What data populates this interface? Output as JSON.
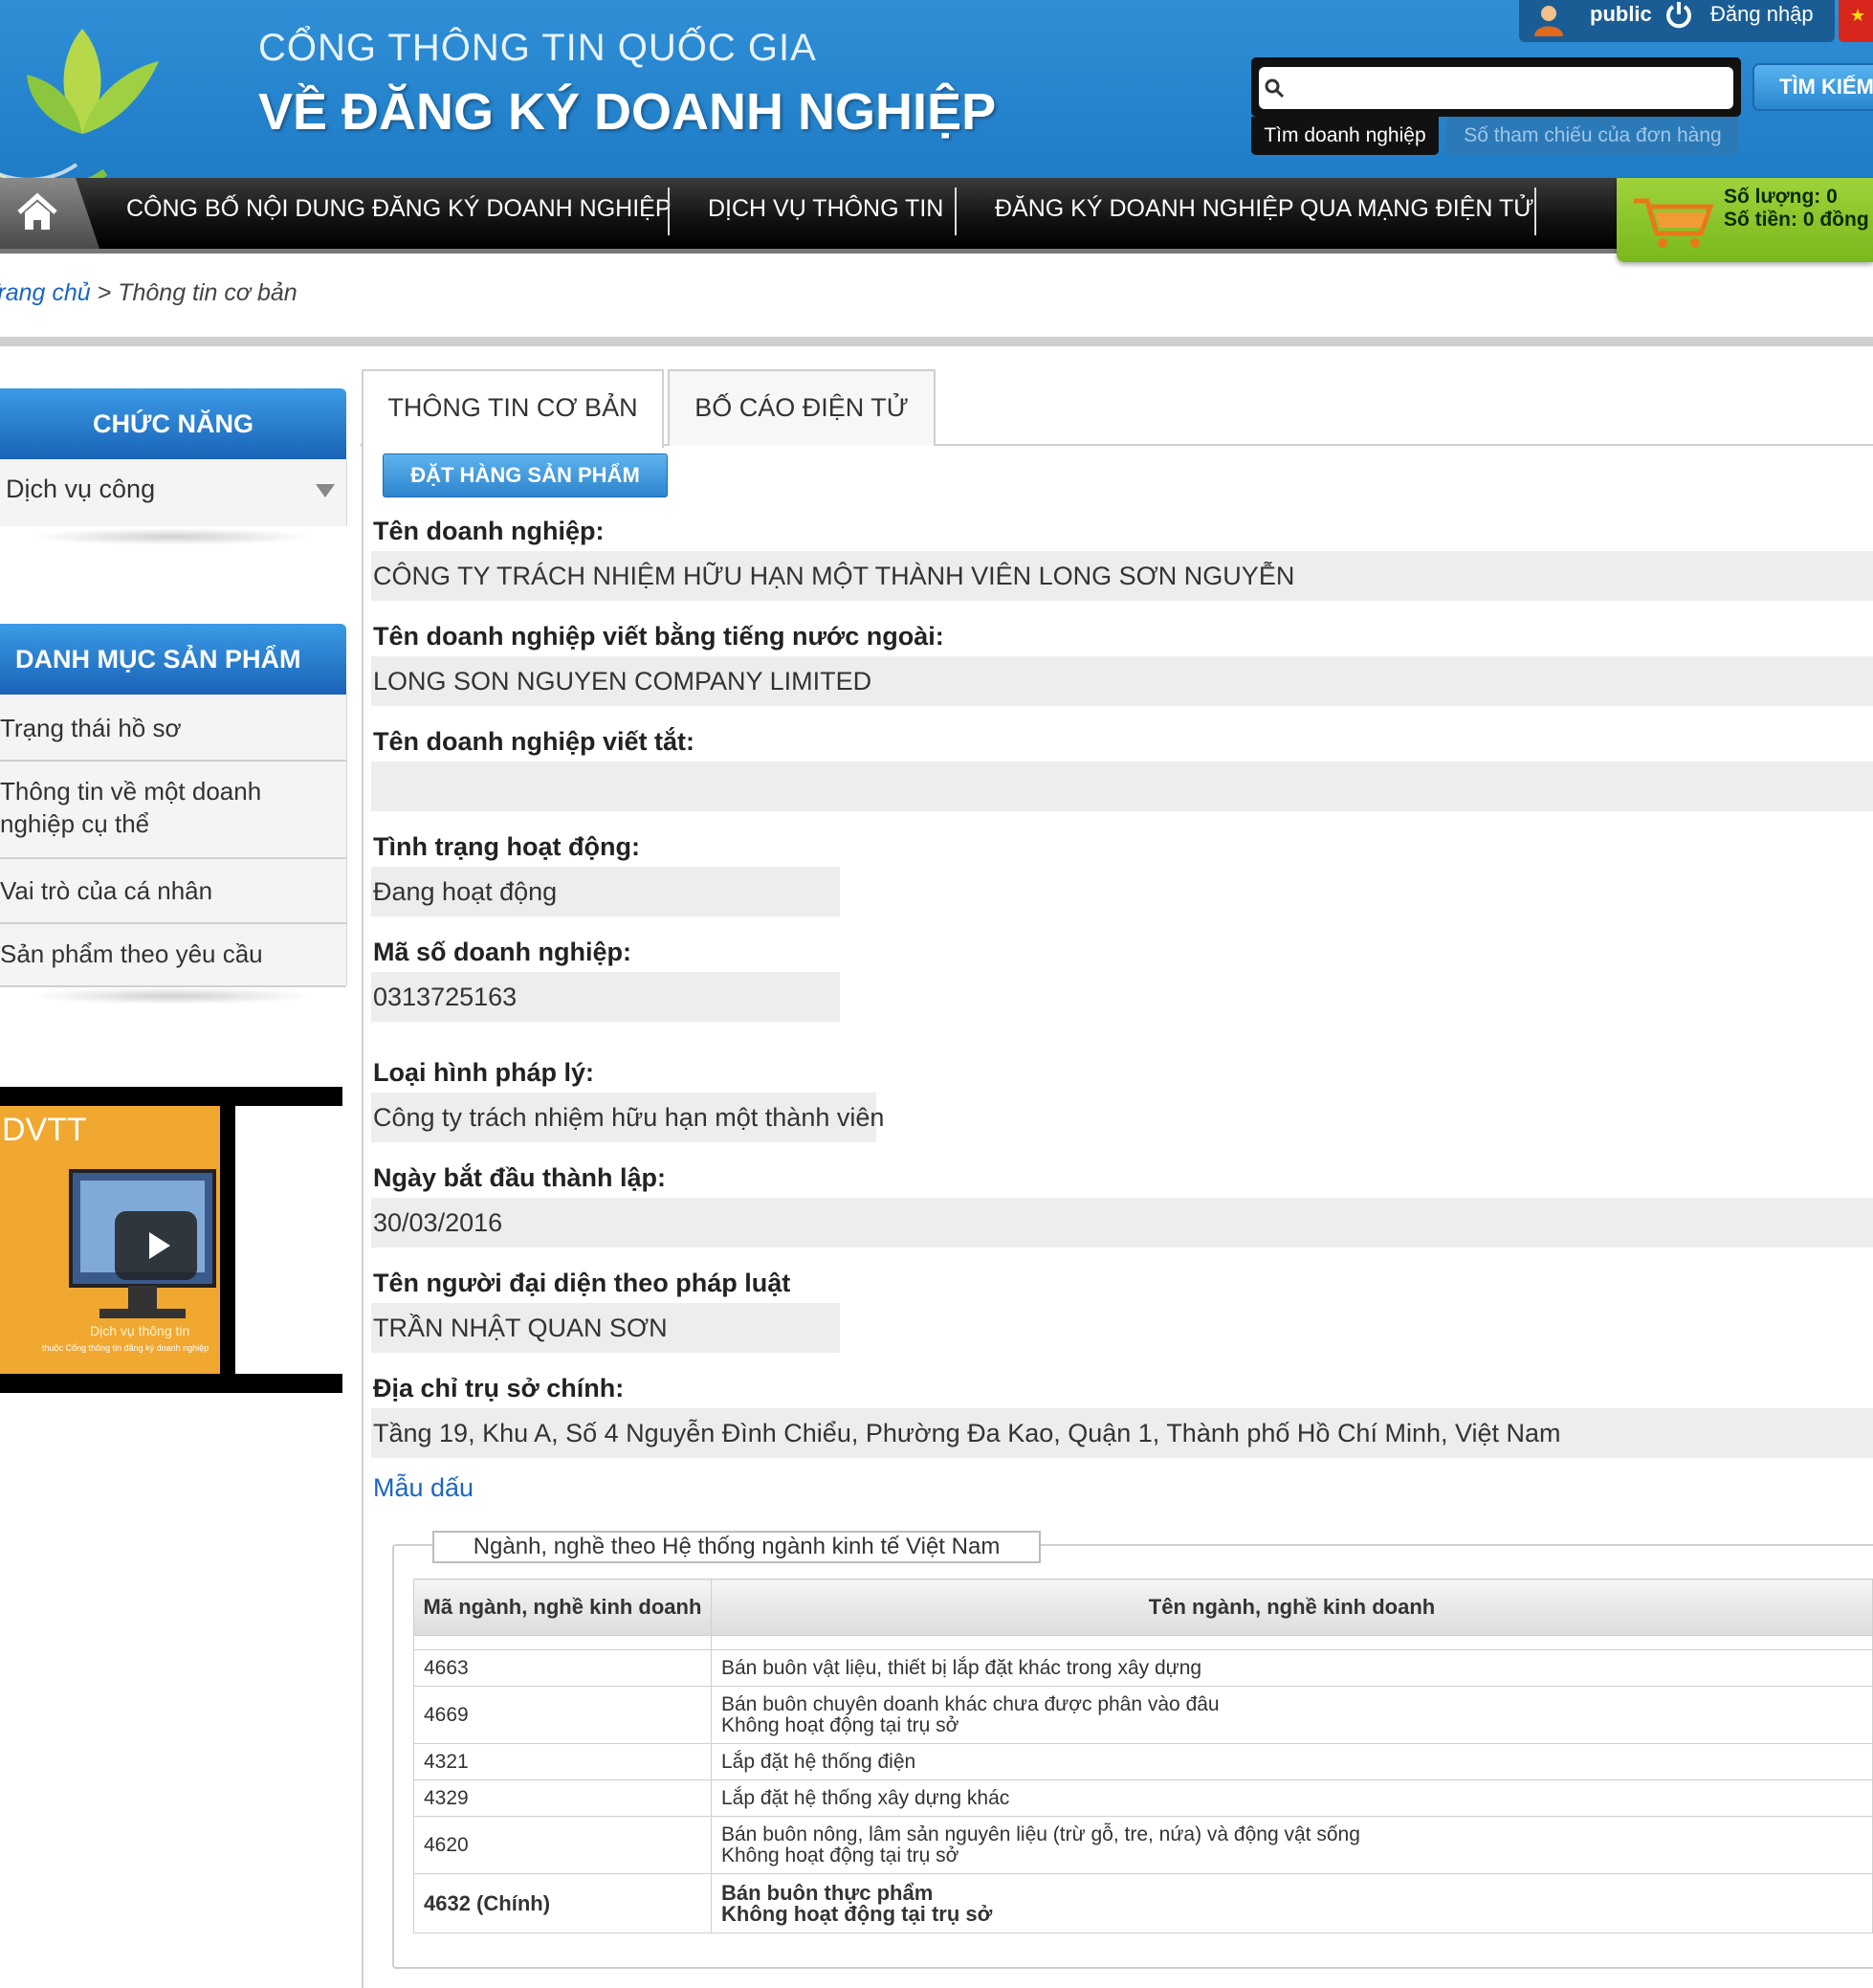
{
  "header": {
    "title_line1": "CỔNG THÔNG TIN QUỐC GIA",
    "title_line2": "VỀ ĐĂNG KÝ DOANH NGHIỆP",
    "user_name": "public",
    "login_label": "Đăng nhập",
    "search_placeholder": "",
    "search_button": "TÌM KIẾM",
    "search_tab_active": "Tìm doanh nghiệp",
    "search_tab_other": "Số tham chiếu của đơn hàng"
  },
  "nav": {
    "items": [
      "CÔNG BỐ NỘI DUNG ĐĂNG KÝ DOANH NGHIỆP",
      "DỊCH VỤ THÔNG TIN",
      "ĐĂNG KÝ DOANH NGHIỆP QUA MẠNG ĐIỆN TỬ"
    ]
  },
  "cart": {
    "quantity_line": "Số lượng: 0",
    "amount_line": "Số tiền: 0 đồng"
  },
  "breadcrumb": {
    "home": "Trang chủ",
    "separator": " > ",
    "current": "Thông tin cơ bản"
  },
  "sidebar": {
    "functions_title": "CHỨC NĂNG",
    "functions_selected": "Dịch vụ công",
    "catalog_title": "DANH MỤC SẢN PHẨM",
    "catalog_items": [
      "Trạng thái hồ sơ",
      "Thông tin về một doanh nghiệp cụ thể",
      "Vai trò của cá nhân",
      "Sản phẩm theo yêu cầu"
    ],
    "video": {
      "title": "DVTT",
      "caption1": "Dịch vụ thông tin",
      "caption2": "thuộc Cổng thông tin đăng ký doanh nghiệp"
    }
  },
  "tabs": [
    "THÔNG TIN CƠ BẢN",
    "BỐ CÁO ĐIỆN TỬ"
  ],
  "order_button": "ĐẶT HÀNG SẢN PHẨM",
  "fields": {
    "name_label": "Tên doanh nghiệp:",
    "name_value": "CÔNG TY TRÁCH NHIỆM HỮU HẠN MỘT THÀNH VIÊN LONG SƠN NGUYỄN",
    "foreign_label": "Tên doanh nghiệp viết bằng tiếng nước ngoài:",
    "foreign_value": "LONG SON NGUYEN COMPANY LIMITED",
    "short_label": "Tên doanh nghiệp viết tắt:",
    "short_value": "",
    "status_label": "Tình trạng hoạt động:",
    "status_value": "Đang hoạt động",
    "code_label": "Mã số doanh nghiệp:",
    "code_value": "0313725163",
    "legal_label": "Loại hình pháp lý:",
    "legal_value": "Công ty trách nhiệm hữu hạn một thành viên",
    "date_label": "Ngày bắt đầu thành lập:",
    "date_value": "30/03/2016",
    "rep_label": "Tên người đại diện theo pháp luật",
    "rep_value": "TRẦN NHẬT QUAN SƠN",
    "address_label": "Địa chỉ trụ sở chính:",
    "address_value": "Tầng 19, Khu A, Số 4 Nguyễn Đình Chiểu, Phường Đa Kao, Quận 1, Thành phố Hồ Chí Minh, Việt Nam",
    "seal_link": "Mẫu dấu"
  },
  "industries": {
    "legend": "Ngành, nghề theo Hệ thống ngành kinh tế Việt Nam",
    "col_code": "Mã ngành, nghề kinh doanh",
    "col_name": "Tên ngành, nghề kinh doanh",
    "rows": [
      {
        "code": "4663",
        "name": "Bán buôn vật liệu, thiết bị lắp đặt khác trong xây dựng",
        "note": ""
      },
      {
        "code": "4669",
        "name": "Bán buôn chuyên doanh khác chưa được phân vào đâu",
        "note": "Không hoạt động tại trụ sở"
      },
      {
        "code": "4321",
        "name": "Lắp đặt hệ thống điện",
        "note": ""
      },
      {
        "code": "4329",
        "name": "Lắp đặt hệ thống xây dựng khác",
        "note": ""
      },
      {
        "code": "4620",
        "name": "Bán buôn nông, lâm sản nguyên liệu (trừ gỗ, tre, nứa) và động vật sống",
        "note": "Không hoạt động tại trụ sở"
      },
      {
        "code": "4632 (Chính)",
        "name": "Bán buôn thực phẩm",
        "note": "Không hoạt động tại trụ sở"
      }
    ]
  }
}
